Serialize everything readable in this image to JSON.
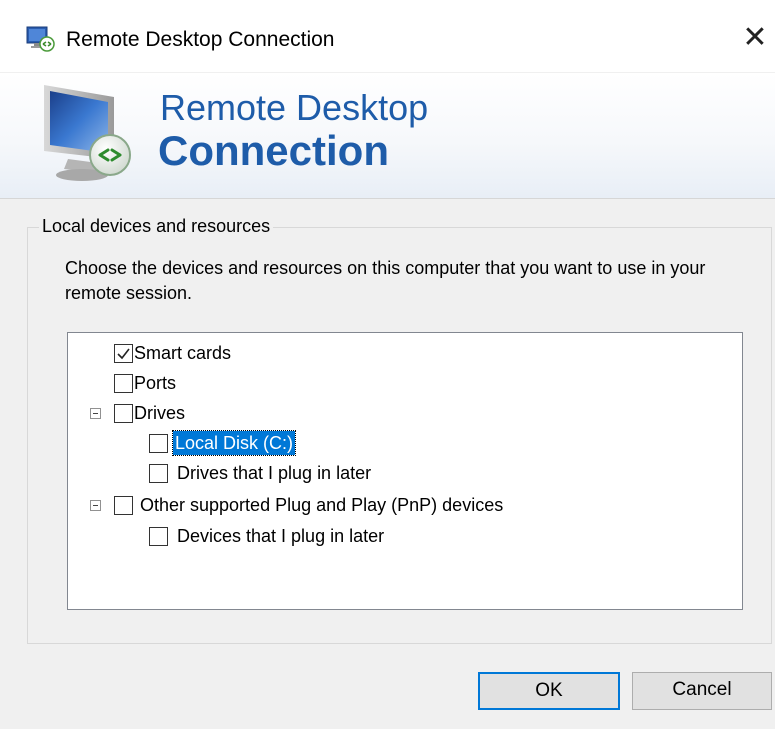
{
  "window": {
    "title": "Remote Desktop Connection",
    "close_glyph": "✕",
    "icon": "remote-desktop-icon"
  },
  "banner": {
    "line1": "Remote Desktop",
    "line2": "Connection",
    "icon": "monitor-remote-icon",
    "accent_color": "#1e5ca9"
  },
  "group": {
    "title": "Local devices and resources",
    "description": "Choose the devices and resources on this computer that you want to use in your remote session."
  },
  "tree": {
    "items": [
      {
        "label": "Smart cards",
        "checked": true
      },
      {
        "label": "Ports",
        "checked": false
      },
      {
        "label": "Drives",
        "checked": false,
        "expanded": true
      },
      {
        "label": "Local Disk (C:)",
        "checked": false,
        "selected": true
      },
      {
        "label": "Drives that I plug in later",
        "checked": false
      },
      {
        "label": "Other supported Plug and Play (PnP) devices",
        "checked": false,
        "expanded": true
      },
      {
        "label": "Devices that I plug in later",
        "checked": false
      }
    ],
    "selection_color": "#0078d7"
  },
  "buttons": {
    "ok": "OK",
    "cancel": "Cancel"
  }
}
